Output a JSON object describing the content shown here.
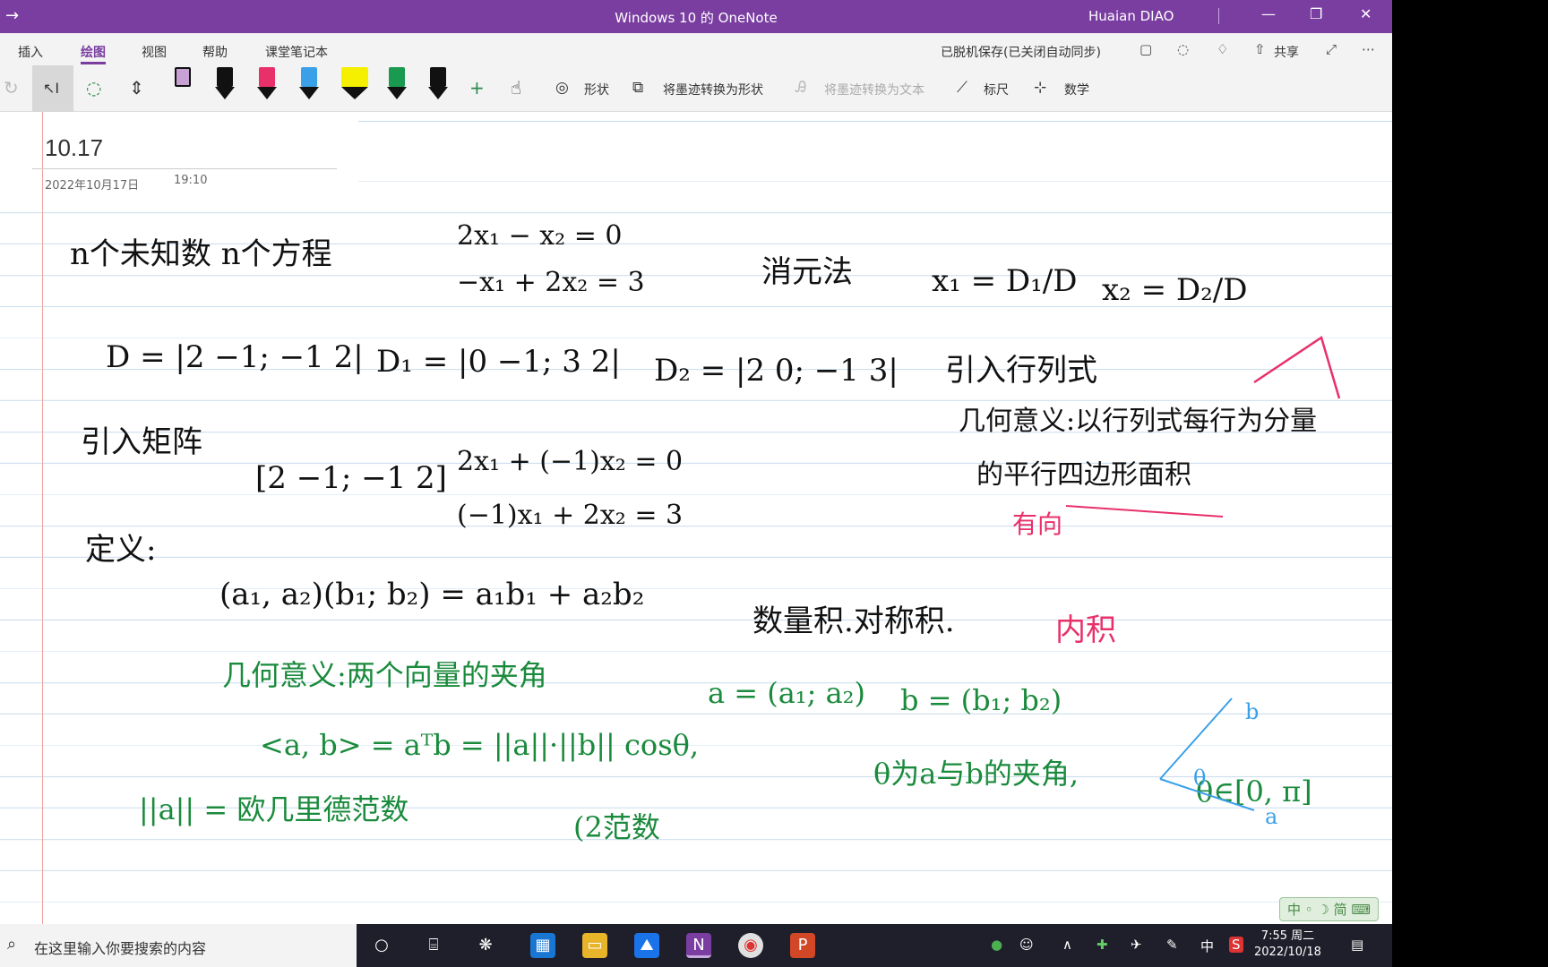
{
  "window": {
    "title": "Windows 10 的 OneNote",
    "user": "Huaian DIAO",
    "back_glyph": "→",
    "minimize_glyph": "—",
    "maximize_glyph": "❐",
    "close_glyph": "✕"
  },
  "menu": {
    "items": [
      "插入",
      "绘图",
      "视图",
      "帮助",
      "课堂笔记本"
    ],
    "sync_status": "已脱机保存(已关闭自动同步)",
    "share_label": "共享"
  },
  "toolbar": {
    "shapes_label": "形状",
    "ink_to_shape_label": "将墨迹转换为形状",
    "ink_to_text_label": "将墨迹转换为文本",
    "ruler_label": "标尺",
    "math_label": "数学",
    "pen_colors": [
      "#c7a0d4",
      "#111111",
      "#e8306a",
      "#3aa0e8",
      "#f5f000",
      "#1a9a50",
      "#111111"
    ]
  },
  "page": {
    "title": "10.17",
    "date": "2022年10月17日",
    "time": "19:10"
  },
  "ink": {
    "line1": "n个未知数 n个方程",
    "system1_eq1": "2x₁ − x₂ = 0",
    "system1_eq2": "−x₁ + 2x₂ = 3",
    "elimination": "消元法",
    "x1_expr": "x₁ = D₁/D",
    "x2_expr": "x₂ = D₂/D",
    "det_D": "D = |2 −1; −1 2|",
    "det_D1": "D₁ = |0 −1; 3 2|",
    "det_D2": "D₂ = |2 0; −1 3|",
    "intro_det": "引入行列式",
    "geo1": "几何意义:以行列式每行为分量",
    "geo2": "的平行四边形面积",
    "directed": "有向",
    "intro_matrix": "引入矩阵",
    "matrix": "[2 −1; −1 2]",
    "system2_eq1": "2x₁ + (−1)x₂ = 0",
    "system2_eq2": "(−1)x₁ + 2x₂ = 3",
    "definition": "定义:",
    "dot_product": "(a₁, a₂)(b₁; b₂) = a₁b₁ + a₂b₂",
    "dot_names": "数量积.对称积.",
    "inner_product": "内积",
    "geo_angle": "几何意义:两个向量的夹角",
    "vec_a": "a = (a₁; a₂)",
    "vec_b": "b = (b₁; b₂)",
    "angle_formula": "<a, b> = aᵀb = ||a||·||b|| cosθ,",
    "theta_desc": "θ为a与b的夹角,",
    "theta_range": "θ∈[0, π]",
    "norm_def": "||a|| = 欧几里德范数",
    "two_norm": "(2范数",
    "vec_label_a": "a",
    "vec_label_b": "b",
    "theta": "θ"
  },
  "taskbar": {
    "search_placeholder": "在这里输入你要搜索的内容",
    "ime": "中",
    "clock_time": "7:55 周二",
    "clock_date": "2022/10/18",
    "ime_badge": "中 ◦ ☽ 简 ⌨"
  }
}
